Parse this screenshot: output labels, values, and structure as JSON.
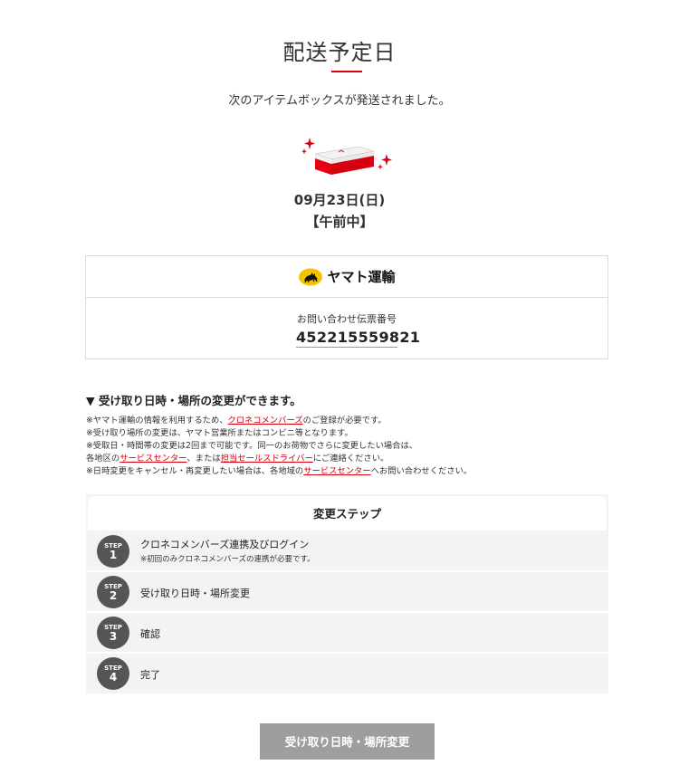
{
  "header": {
    "title": "配送予定日",
    "subtitle": "次のアイテムボックスが発送されました。"
  },
  "shipment": {
    "date": "09月23日(日)",
    "time_window": "【午前中】"
  },
  "tracking": {
    "carrier_name": "ヤマト運輸",
    "carrier_logo_icon": "black-cat-icon",
    "label": "お問い合わせ伝票番号",
    "number": "452215559821"
  },
  "notice": {
    "heading": "▼ 受け取り日時・場所の変更ができます。",
    "line1_pre": "※ヤマト運輸の情報を利用するため、",
    "line1_link": "クロネコメンバーズ",
    "line1_post": "のご登録が必要です。",
    "line2": "※受け取り場所の変更は、ヤマト営業所またはコンビニ等となります。",
    "line3": "※受取日・時間帯の変更は2回まで可能です。同一のお荷物でさらに変更したい場合は、",
    "line4_pre": "各地区の",
    "line4_link1": "サービスセンター",
    "line4_mid": "、または",
    "line4_link2": "担当セールスドライバー",
    "line4_post": "にご連絡ください。",
    "line5_pre": "※日時変更をキャンセル・再変更したい場合は、各地域の",
    "line5_link": "サービスセンター",
    "line5_post": "へお問い合わせください。"
  },
  "steps": {
    "heading": "変更ステップ",
    "badge_word": "STEP",
    "items": [
      {
        "number": "1",
        "title": "クロネコメンバーズ連携及びログイン",
        "note": "※初回のみクロネコメンバーズの連携が必要です。"
      },
      {
        "number": "2",
        "title": "受け取り日時・場所変更",
        "note": ""
      },
      {
        "number": "3",
        "title": "確認",
        "note": ""
      },
      {
        "number": "4",
        "title": "完了",
        "note": ""
      }
    ]
  },
  "cta": {
    "label": "受け取り日時・場所変更"
  },
  "colors": {
    "accent": "#d7000f",
    "badge": "#555555",
    "button": "#9e9e9e",
    "steps_bg": "#f3f3f3"
  }
}
